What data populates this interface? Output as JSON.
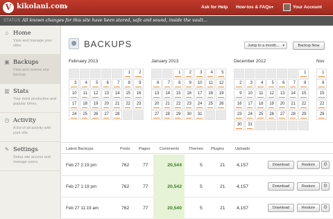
{
  "topbar": {
    "logo_glyph": "V",
    "site_name": "kikolani.com",
    "ask_help": "Ask for Help",
    "howtos": "How-tos & FAQs",
    "account": "Your Account",
    "caret": "▾"
  },
  "status": {
    "label": "STATUS",
    "text": "All known changes for this site have been stored, safe and sound, inside the vault..."
  },
  "sidebar": {
    "items": [
      {
        "title": "Home",
        "desc": "View and manage your sites",
        "icon": "home-icon"
      },
      {
        "title": "Backups",
        "desc": "View and restore any backup.",
        "icon": "backup-icon"
      },
      {
        "title": "Stats",
        "desc": "Your most productive and popular times.",
        "icon": "stats-icon"
      },
      {
        "title": "Activity",
        "desc": "A list of all activity with your site.",
        "icon": "activity-icon"
      },
      {
        "title": "Settings",
        "desc": "Setup site access and manage users.",
        "icon": "settings-icon"
      }
    ]
  },
  "main": {
    "page_title": "BACKUPS",
    "jump_placeholder": "Jump to a month...",
    "backup_now": "Backup Now"
  },
  "calendars": [
    {
      "name": "February 2013",
      "weeks": [
        [
          "",
          "",
          "",
          "",
          "",
          "1",
          "2"
        ],
        [
          "3",
          "4",
          "5",
          "6",
          "7",
          "8",
          "9"
        ],
        [
          "10",
          "11",
          "12",
          "13",
          "14",
          "15",
          "16"
        ],
        [
          "17",
          "18",
          "19",
          "20",
          "21",
          "22",
          "23"
        ],
        [
          "24",
          "25",
          "26",
          "27",
          "28",
          "",
          ""
        ]
      ]
    },
    {
      "name": "January 2013",
      "weeks": [
        [
          "",
          "",
          "1",
          "2",
          "3",
          "4",
          "5"
        ],
        [
          "6",
          "7",
          "8",
          "9",
          "10",
          "11",
          "12"
        ],
        [
          "13",
          "14",
          "15",
          "16",
          "17",
          "18",
          "19"
        ],
        [
          "20",
          "21",
          "22",
          "23",
          "24",
          "25",
          "26"
        ],
        [
          "27",
          "28",
          "29",
          "30",
          "31",
          "",
          ""
        ]
      ]
    },
    {
      "name": "December 2012",
      "weeks": [
        [
          "",
          "",
          "",
          "",
          "",
          "",
          "1"
        ],
        [
          "2",
          "3",
          "4",
          "5",
          "6",
          "7",
          "8"
        ],
        [
          "9",
          "10",
          "11",
          "12",
          "13",
          "14",
          "15"
        ],
        [
          "16",
          "17",
          "18",
          "19",
          "20",
          "21",
          "22"
        ],
        [
          "23",
          "24",
          "25",
          "26",
          "27",
          "28",
          "29"
        ],
        [
          "30",
          "31",
          "",
          "",
          "",
          "",
          ""
        ]
      ]
    },
    {
      "name": "Nov",
      "weeks": [
        [
          "1"
        ],
        [
          "8"
        ],
        [
          "15"
        ],
        [
          "22"
        ],
        [
          "29"
        ]
      ]
    }
  ],
  "table": {
    "headers": [
      "Latest Backups",
      "Posts",
      "Pages",
      "Comments",
      "Themes",
      "Plugins",
      "Uploads"
    ],
    "rows": [
      {
        "date": "Feb 27 2:19 pm",
        "posts": "762",
        "pages": "77",
        "comments": "20,544",
        "themes": "5",
        "plugins": "21",
        "uploads": "4,157"
      },
      {
        "date": "Feb 27 1:19 pm",
        "posts": "762",
        "pages": "77",
        "comments": "20,542",
        "themes": "5",
        "plugins": "21",
        "uploads": "4,157"
      },
      {
        "date": "Feb 27 11:19 am",
        "posts": "762",
        "pages": "77",
        "comments": "20,540",
        "themes": "5",
        "plugins": "21",
        "uploads": "4,157"
      }
    ],
    "download_label": "Download",
    "restore_label": "Restore"
  },
  "colors": {
    "brand": "#b12e24",
    "status_bar": "#555555",
    "backup_mark": "#e48a3a",
    "comments_highlight": "#e6f3d6"
  }
}
